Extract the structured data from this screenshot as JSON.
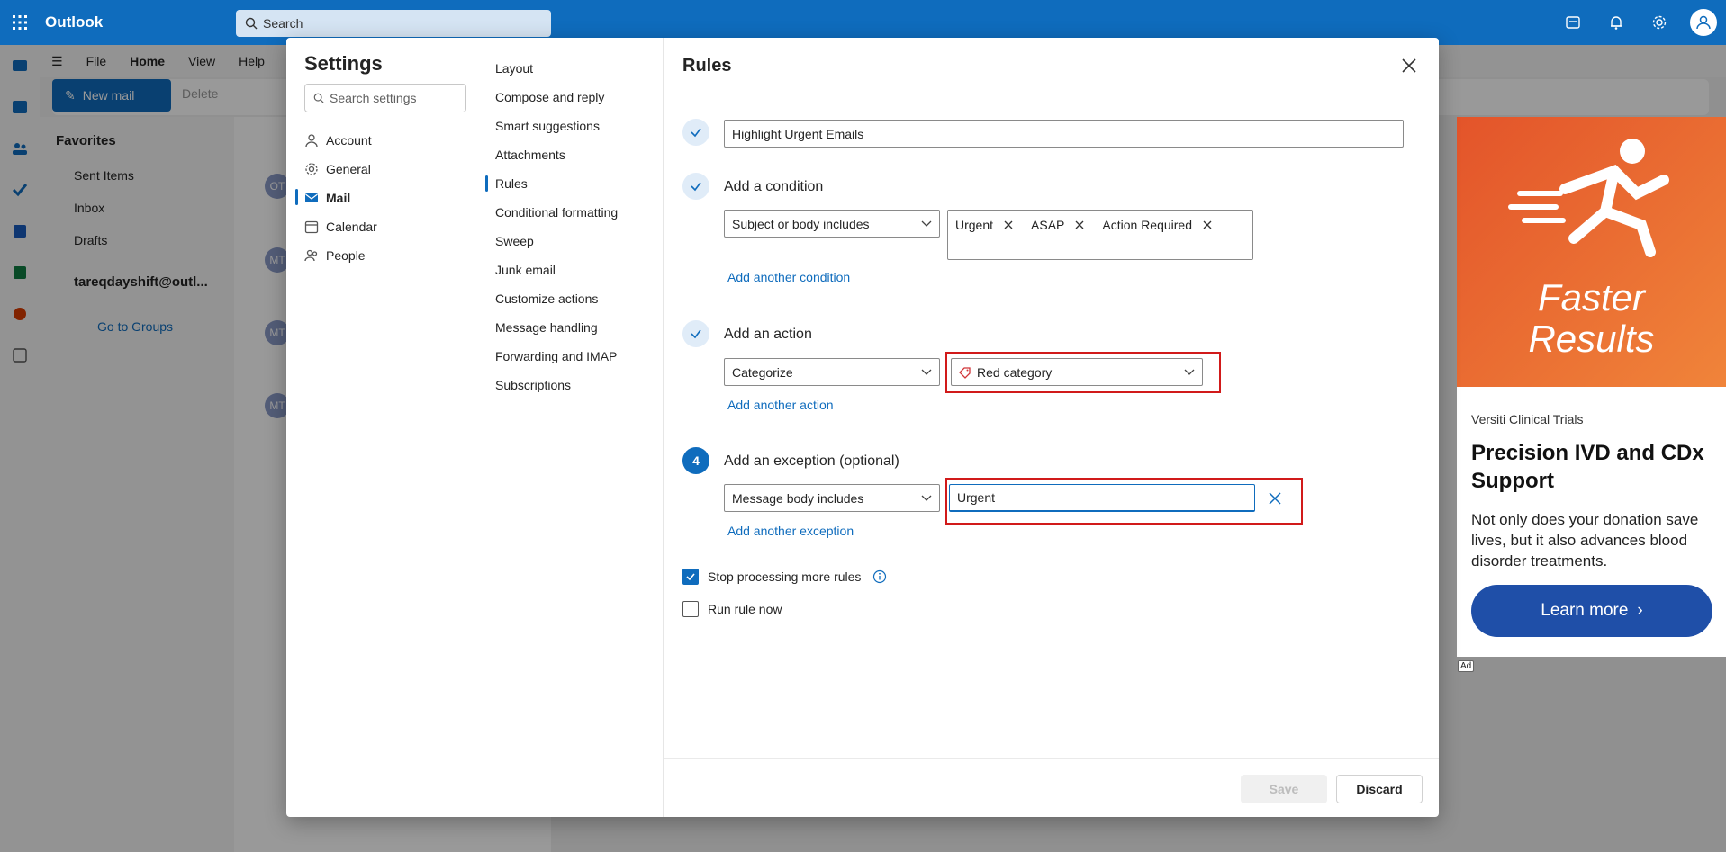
{
  "topbar": {
    "app_name": "Outlook",
    "search_placeholder": "Search",
    "icons": [
      "waffle-icon",
      "my-day-icon",
      "bell-icon",
      "gear-icon",
      "account-icon"
    ]
  },
  "ribbon": {
    "tabs": [
      "File",
      "Home",
      "View",
      "Help"
    ],
    "new_mail": "New mail",
    "delete": "Delete"
  },
  "folders": {
    "favorites": "Favorites",
    "items": [
      "Sent Items",
      "Inbox",
      "Drafts"
    ],
    "account": "tareqdayshift@outl...",
    "groups": "Go to Groups"
  },
  "messages": {
    "avatars": [
      "OT",
      "MT",
      "MT",
      "MT"
    ]
  },
  "ad": {
    "image_text_line1": "Faster",
    "image_text_line2": "Results",
    "brand": "Versiti Clinical Trials",
    "headline": "Precision IVD and CDx Support",
    "body": "Not only does your donation save lives, but it also advances blood disorder treatments.",
    "cta": "Learn more",
    "badge": "Ad"
  },
  "settings": {
    "title": "Settings",
    "search_placeholder": "Search settings",
    "categories": [
      {
        "label": "Account",
        "icon": "person-icon"
      },
      {
        "label": "General",
        "icon": "gear-icon"
      },
      {
        "label": "Mail",
        "icon": "mail-icon"
      },
      {
        "label": "Calendar",
        "icon": "calendar-icon"
      },
      {
        "label": "People",
        "icon": "people-icon"
      }
    ],
    "active_category": "Mail",
    "subcategories": [
      "Layout",
      "Compose and reply",
      "Smart suggestions",
      "Attachments",
      "Rules",
      "Conditional formatting",
      "Sweep",
      "Junk email",
      "Customize actions",
      "Message handling",
      "Forwarding and IMAP",
      "Subscriptions"
    ],
    "active_subcategory": "Rules"
  },
  "rules": {
    "title": "Rules",
    "rule_name": "Highlight Urgent Emails",
    "condition": {
      "label": "Add a condition",
      "type": "Subject or body includes",
      "keywords": [
        "Urgent",
        "ASAP",
        "Action Required"
      ],
      "add_link": "Add another condition"
    },
    "action": {
      "label": "Add an action",
      "type": "Categorize",
      "value": "Red category",
      "add_link": "Add another action"
    },
    "exception": {
      "step_number": "4",
      "label": "Add an exception (optional)",
      "type": "Message body includes",
      "value": "Urgent",
      "add_link": "Add another exception"
    },
    "stop_processing": {
      "label": "Stop processing more rules",
      "checked": true
    },
    "run_now": {
      "label": "Run rule now",
      "checked": false
    },
    "save": "Save",
    "discard": "Discard"
  },
  "colors": {
    "brand": "#0f6cbd",
    "highlight": "#d11a1a"
  }
}
